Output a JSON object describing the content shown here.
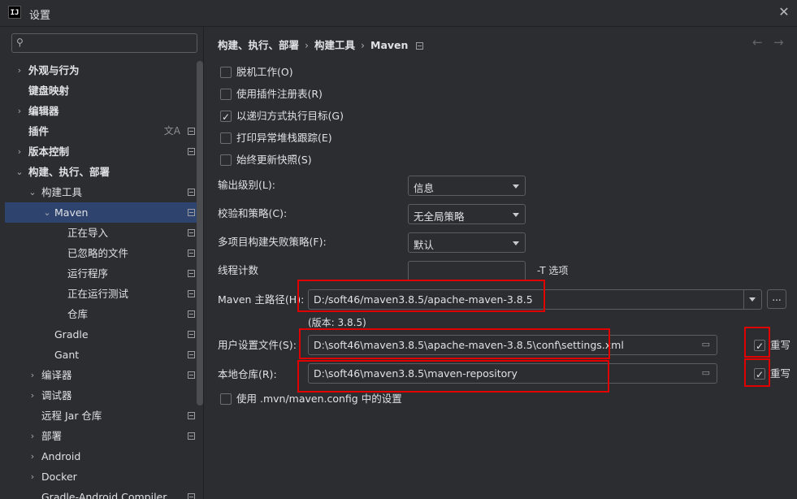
{
  "window": {
    "app_icon": "IJ",
    "title": "设置",
    "close": "✕"
  },
  "sidebar": {
    "search": {
      "placeholder": ""
    },
    "items": [
      {
        "label": "外观与行为",
        "chev": "›",
        "indent": 0,
        "bold": true,
        "pref": false
      },
      {
        "label": "键盘映射",
        "chev": "",
        "indent": 0,
        "bold": true,
        "pref": false
      },
      {
        "label": "编辑器",
        "chev": "›",
        "indent": 0,
        "bold": true,
        "pref": false
      },
      {
        "label": "插件",
        "chev": "",
        "indent": 0,
        "bold": true,
        "pref": true,
        "trans": "文A"
      },
      {
        "label": "版本控制",
        "chev": "›",
        "indent": 0,
        "bold": true,
        "pref": true
      },
      {
        "label": "构建、执行、部署",
        "chev": "⌄",
        "indent": 0,
        "bold": true,
        "pref": false
      },
      {
        "label": "构建工具",
        "chev": "⌄",
        "indent": 1,
        "bold": false,
        "pref": true
      },
      {
        "label": "Maven",
        "chev": "⌄",
        "indent": 2,
        "bold": false,
        "pref": true,
        "selected": true
      },
      {
        "label": "正在导入",
        "chev": "",
        "indent": 3,
        "bold": false,
        "pref": true
      },
      {
        "label": "已忽略的文件",
        "chev": "",
        "indent": 3,
        "bold": false,
        "pref": true
      },
      {
        "label": "运行程序",
        "chev": "",
        "indent": 3,
        "bold": false,
        "pref": true
      },
      {
        "label": "正在运行测试",
        "chev": "",
        "indent": 3,
        "bold": false,
        "pref": true
      },
      {
        "label": "仓库",
        "chev": "",
        "indent": 3,
        "bold": false,
        "pref": true
      },
      {
        "label": "Gradle",
        "chev": "",
        "indent": 2,
        "bold": false,
        "pref": true
      },
      {
        "label": "Gant",
        "chev": "",
        "indent": 2,
        "bold": false,
        "pref": true
      },
      {
        "label": "编译器",
        "chev": "›",
        "indent": 1,
        "bold": false,
        "pref": true
      },
      {
        "label": "调试器",
        "chev": "›",
        "indent": 1,
        "bold": false,
        "pref": false
      },
      {
        "label": "远程 Jar 仓库",
        "chev": "",
        "indent": 1,
        "bold": false,
        "pref": true
      },
      {
        "label": "部署",
        "chev": "›",
        "indent": 1,
        "bold": false,
        "pref": true
      },
      {
        "label": "Android",
        "chev": "›",
        "indent": 1,
        "bold": false,
        "pref": false
      },
      {
        "label": "Docker",
        "chev": "›",
        "indent": 1,
        "bold": false,
        "pref": false
      },
      {
        "label": "Gradle-Android Compiler",
        "chev": "",
        "indent": 1,
        "bold": false,
        "pref": true
      }
    ]
  },
  "breadcrumb": {
    "part1": "构建、执行、部署",
    "sep": "›",
    "part2": "构建工具",
    "part3": "Maven"
  },
  "nav": {
    "back": "←",
    "forward": "→"
  },
  "options": {
    "offline": {
      "label": "脱机工作(O)",
      "checked": false
    },
    "plugin_registry": {
      "label": "使用插件注册表(R)",
      "checked": false
    },
    "recursive": {
      "label": "以递归方式执行目标(G)",
      "checked": true
    },
    "print_stack": {
      "label": "打印异常堆栈跟踪(E)",
      "checked": false
    },
    "always_update": {
      "label": "始终更新快照(S)",
      "checked": false
    }
  },
  "fields": {
    "output_level": {
      "label": "输出级别(L):",
      "value": "信息"
    },
    "checksum": {
      "label": "校验和策略(C):",
      "value": "无全局策略"
    },
    "fail_policy": {
      "label": "多项目构建失败策略(F):",
      "value": "默认"
    },
    "thread_count": {
      "label": "线程计数",
      "value": "",
      "suffix": "-T 选项"
    },
    "maven_home": {
      "label": "Maven 主路径(H):",
      "value": "D:/soft46/maven3.8.5/apache-maven-3.8.5",
      "more": "...",
      "version": "(版本: 3.8.5)"
    },
    "user_settings": {
      "label": "用户设置文件(S):",
      "value": "D:\\soft46\\maven3.8.5\\apache-maven-3.8.5\\conf\\settings.xml",
      "override": "重写",
      "override_checked": true
    },
    "local_repo": {
      "label": "本地仓库(R):",
      "value": "D:\\soft46\\maven3.8.5\\maven-repository",
      "override": "重写",
      "override_checked": true
    },
    "mvn_config": {
      "label": "使用 .mvn/maven.config 中的设置",
      "checked": false
    }
  },
  "colors": {
    "selection": "#2e436e",
    "highlight": "#e00000",
    "background": "#2b2d30"
  }
}
